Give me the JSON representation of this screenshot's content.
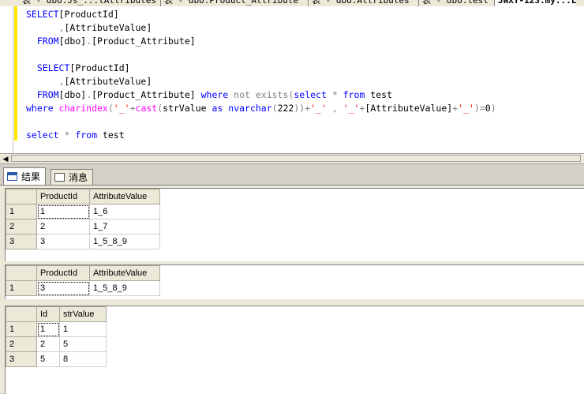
{
  "doc_tabs": [
    {
      "label": "表 - dbo.Js_...tAttributes",
      "active": false
    },
    {
      "label": "表 - dbo.Product_Attribute",
      "active": false
    },
    {
      "label": "表 - dbo.Attributes",
      "active": false
    },
    {
      "label": "表 - dbo.test",
      "active": false
    },
    {
      "label": "JWXY-123.my...L",
      "active": true
    }
  ],
  "editor": {
    "lines": [
      [
        [
          "kw",
          "SELECT"
        ],
        [
          "",
          "[ProductId]"
        ]
      ],
      [
        [
          "",
          "      "
        ],
        [
          "op",
          ","
        ],
        [
          "",
          "[AttributeValue]"
        ]
      ],
      [
        [
          "",
          "  "
        ],
        [
          "kw",
          "FROM"
        ],
        [
          "",
          "[dbo]"
        ],
        [
          "op",
          "."
        ],
        [
          "",
          "[Product_Attribute]"
        ]
      ],
      [
        [
          "",
          ""
        ]
      ],
      [
        [
          "",
          "  "
        ],
        [
          "kw",
          "SELECT"
        ],
        [
          "",
          "[ProductId]"
        ]
      ],
      [
        [
          "",
          "      "
        ],
        [
          "op",
          ","
        ],
        [
          "",
          "[AttributeValue]"
        ]
      ],
      [
        [
          "",
          "  "
        ],
        [
          "kw",
          "FROM"
        ],
        [
          "",
          "[dbo]"
        ],
        [
          "op",
          "."
        ],
        [
          "",
          "[Product_Attribute] "
        ],
        [
          "kw",
          "where "
        ],
        [
          "op",
          "not exists"
        ],
        [
          "op",
          "("
        ],
        [
          "kw",
          "select "
        ],
        [
          "op",
          "* "
        ],
        [
          "kw",
          "from "
        ],
        [
          "",
          "test"
        ]
      ],
      [
        [
          "kw",
          "where "
        ],
        [
          "fn",
          "charindex"
        ],
        [
          "op",
          "("
        ],
        [
          "str",
          "'_'"
        ],
        [
          "op",
          "+"
        ],
        [
          "fn",
          "cast"
        ],
        [
          "op",
          "("
        ],
        [
          "",
          "strValue "
        ],
        [
          "kw",
          "as "
        ],
        [
          "kw",
          "nvarchar"
        ],
        [
          "op",
          "("
        ],
        [
          "",
          "222"
        ],
        [
          "op",
          "))+"
        ],
        [
          "str",
          "'_'"
        ],
        [
          "op",
          " , "
        ],
        [
          "str",
          "'_'"
        ],
        [
          "op",
          "+"
        ],
        [
          "",
          "[AttributeValue]"
        ],
        [
          "op",
          "+"
        ],
        [
          "str",
          "'_'"
        ],
        [
          "op",
          ")="
        ],
        [
          "",
          "0"
        ],
        [
          "op",
          ")"
        ]
      ],
      [
        [
          "",
          ""
        ]
      ],
      [
        [
          "kw",
          "select "
        ],
        [
          "op",
          "* "
        ],
        [
          "kw",
          "from "
        ],
        [
          "",
          "test"
        ]
      ]
    ]
  },
  "results_tabs": {
    "results": "结果",
    "messages": "消息"
  },
  "result_sets": [
    {
      "columns": [
        "ProductId",
        "AttributeValue"
      ],
      "rows": [
        [
          "1",
          "1_6"
        ],
        [
          "2",
          "1_7"
        ],
        [
          "3",
          "1_5_8_9"
        ]
      ]
    },
    {
      "columns": [
        "ProductId",
        "AttributeValue"
      ],
      "rows": [
        [
          "3",
          "1_5_8_9"
        ]
      ]
    },
    {
      "columns": [
        "Id",
        "strValue"
      ],
      "rows": [
        [
          "1",
          "1"
        ],
        [
          "2",
          "5"
        ],
        [
          "5",
          "8"
        ]
      ]
    }
  ]
}
